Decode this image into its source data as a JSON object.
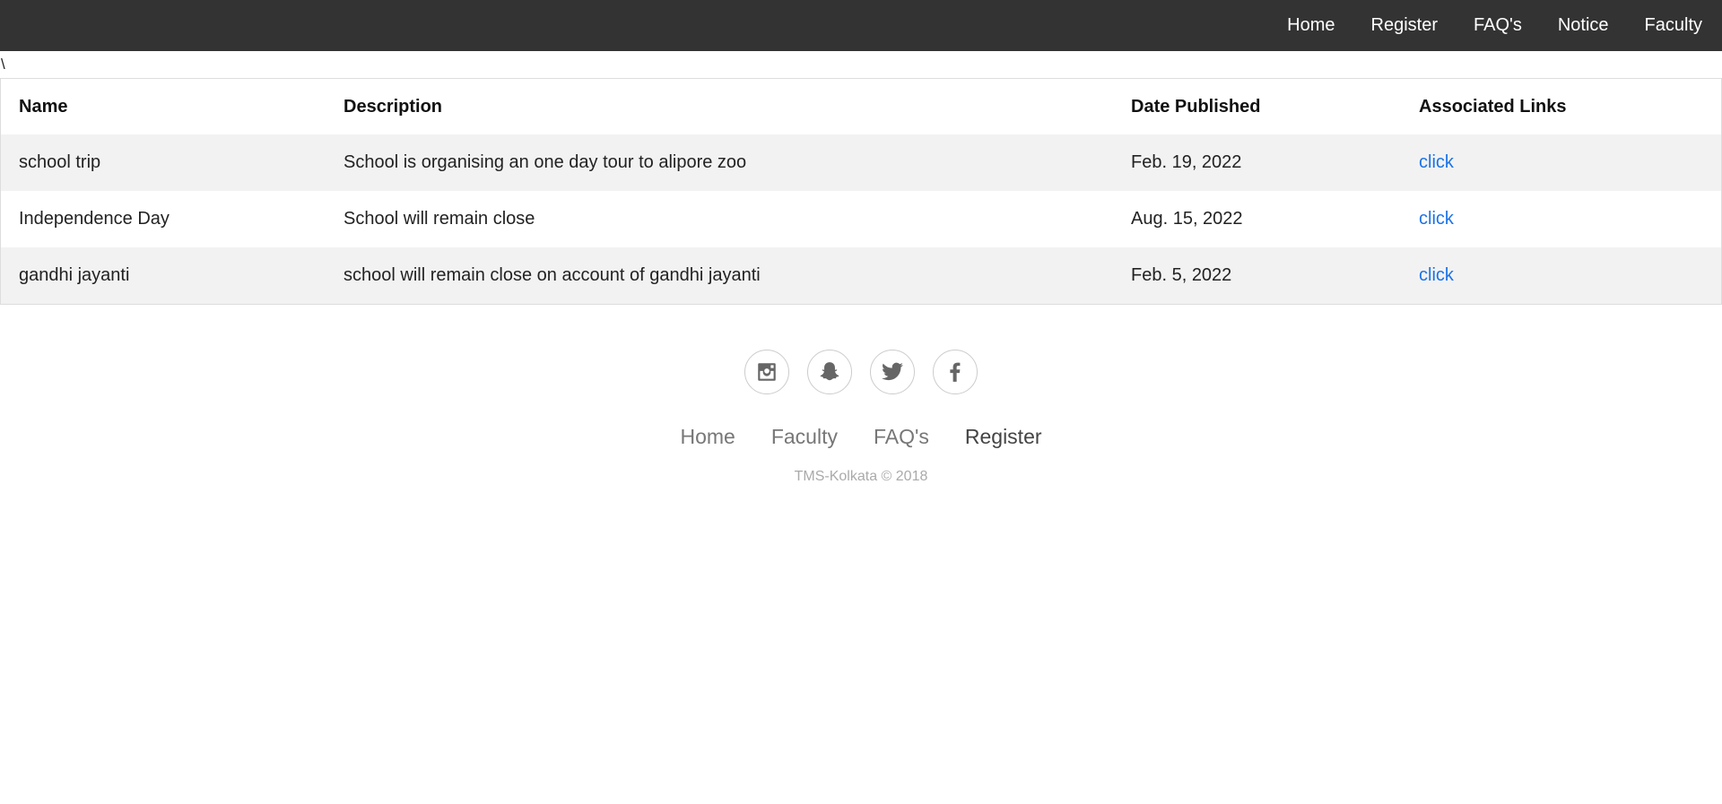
{
  "nav": {
    "items": [
      "Home",
      "Register",
      "FAQ's",
      "Notice",
      "Faculty"
    ]
  },
  "stray_text": "\\",
  "table": {
    "headers": [
      "Name",
      "Description",
      "Date Published",
      "Associated Links"
    ],
    "rows": [
      {
        "name": "school trip",
        "description": "School is organising an one day tour to alipore zoo",
        "date": "Feb. 19, 2022",
        "link": "click"
      },
      {
        "name": "Independence Day",
        "description": "School will remain close",
        "date": "Aug. 15, 2022",
        "link": "click"
      },
      {
        "name": "gandhi jayanti",
        "description": "school will remain close on account of gandhi jayanti",
        "date": "Feb. 5, 2022",
        "link": "click"
      }
    ]
  },
  "footer": {
    "social_icons": [
      "instagram-icon",
      "snapchat-icon",
      "twitter-icon",
      "facebook-icon"
    ],
    "links": [
      "Home",
      "Faculty",
      "FAQ's",
      "Register"
    ],
    "copyright": "TMS-Kolkata © 2018"
  },
  "colors": {
    "nav_bg": "#333333",
    "link": "#1a73e8",
    "row_alt": "#f2f2f2"
  }
}
